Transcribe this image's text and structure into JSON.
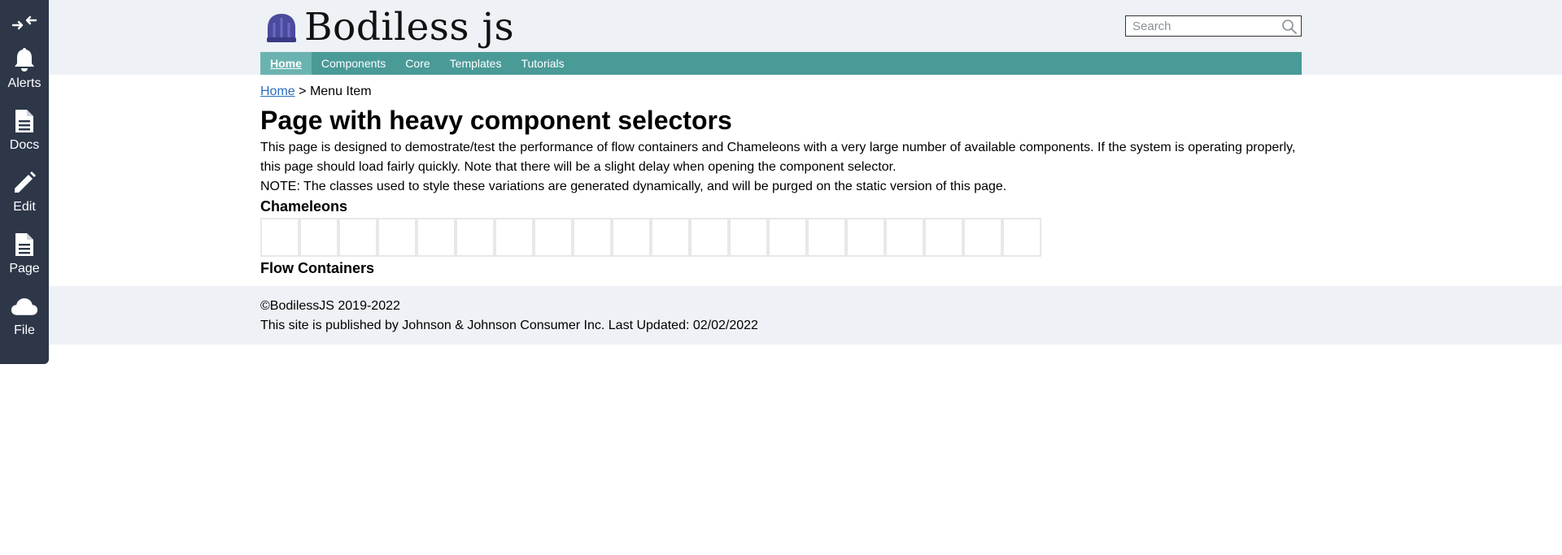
{
  "toolbar": {
    "items": [
      {
        "label": "Alerts",
        "icon": "bell-icon"
      },
      {
        "label": "Docs",
        "icon": "document-icon"
      },
      {
        "label": "Edit",
        "icon": "pencil-icon"
      },
      {
        "label": "Page",
        "icon": "page-icon"
      },
      {
        "label": "File",
        "icon": "cloud-icon"
      }
    ]
  },
  "header": {
    "logo_text": "Bodiless js",
    "search_placeholder": "Search"
  },
  "nav": {
    "items": [
      "Home",
      "Components",
      "Core",
      "Templates",
      "Tutorials"
    ],
    "active": "Home"
  },
  "breadcrumb": {
    "home": "Home",
    "separator": ">",
    "current": "Menu Item"
  },
  "main": {
    "title": "Page with heavy component selectors",
    "intro_1": "This page is designed to demostrate/test the performance of flow containers and Chameleons with a very large number of available components. If the system is operating properly, this page should load fairly quickly. Note that there will be a slight delay when opening the component selector.",
    "intro_2": "NOTE: The classes used to style these variations are generated dynamically, and will be purged on the static version of this page.",
    "chameleons_heading": "Chameleons",
    "chameleon_count": 20,
    "flow_heading": "Flow Containers"
  },
  "footer": {
    "copyright": "©BodilessJS 2019-2022",
    "published": "This site is published by Johnson & Johnson Consumer Inc. Last Updated: 02/02/2022"
  },
  "colors": {
    "toolbar_bg": "#2d3748",
    "header_bg": "#eef1f5",
    "nav_bg": "#4a9a98",
    "nav_active_bg": "#6bb3b1",
    "link": "#2a6ebb",
    "logo_hat": "#4b4a9c"
  }
}
